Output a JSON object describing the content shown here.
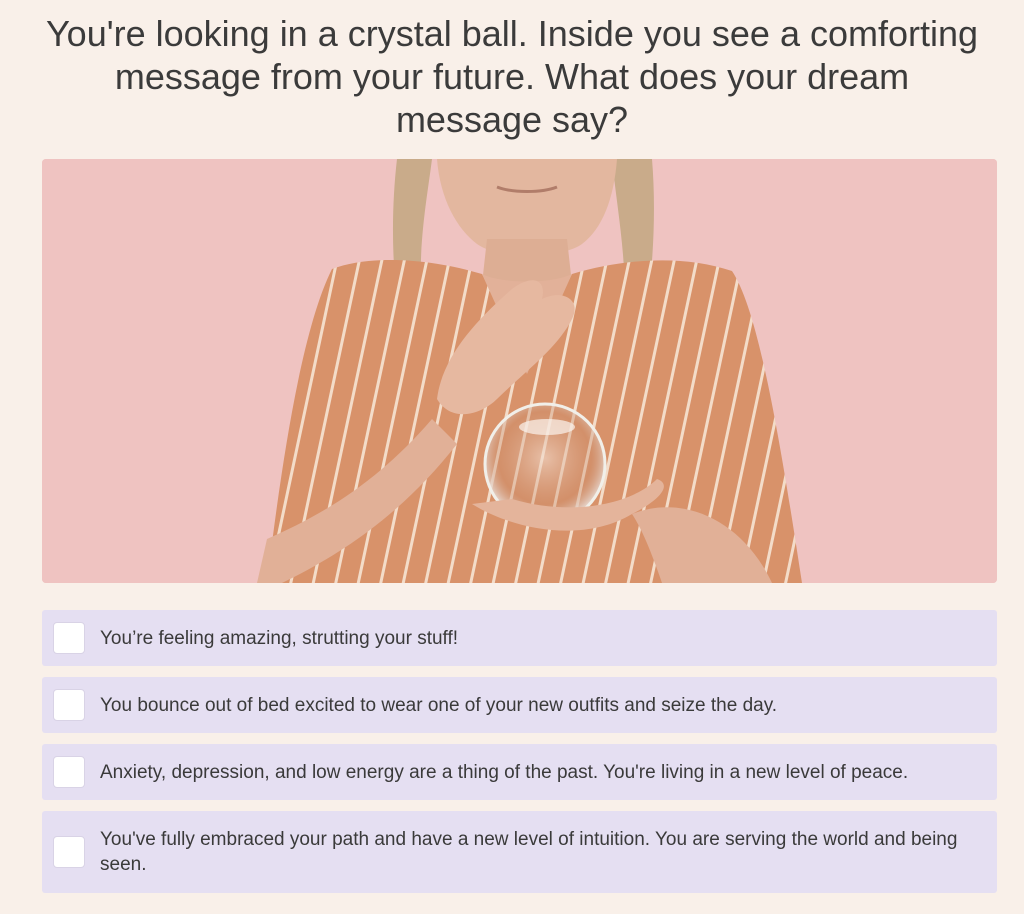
{
  "question": {
    "text": "You're looking in a crystal ball. Inside you see a comforting message from your future. What does your dream message say?"
  },
  "media": {
    "background_color": "#efc3c1",
    "subject": "woman-holding-crystal-ball"
  },
  "options": [
    {
      "label": "You’re feeling amazing, strutting your stuff!",
      "checked": false
    },
    {
      "label": "You bounce out of bed excited to wear one of your new outfits and seize the day.",
      "checked": false
    },
    {
      "label": "Anxiety, depression, and low energy are a thing of the past. You're living in a new level of peace.",
      "checked": false
    },
    {
      "label": "You've fully embraced your path and have a new level of intuition. You are serving the world and being seen.",
      "checked": false
    }
  ],
  "colors": {
    "page_background": "#f9f0e9",
    "option_background": "#e5dff2",
    "text": "#3a3a3a"
  }
}
